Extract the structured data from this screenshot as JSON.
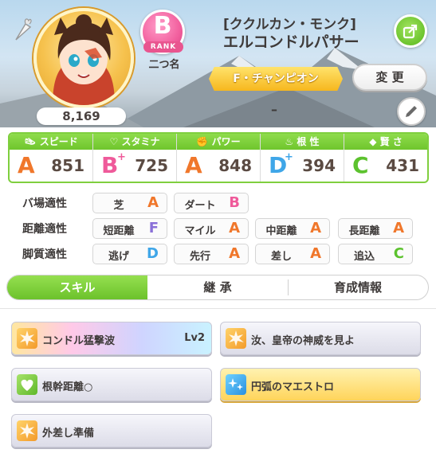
{
  "header": {
    "fans": "8,169",
    "rank": {
      "letter": "B",
      "label": "RANK"
    },
    "nickname": "二つ名",
    "epithet": "[ククルカン・モンク]",
    "uma_name": "エルコンドルパサー",
    "title": "F・チャンピオン",
    "change_label": "変 更",
    "memo": "–"
  },
  "stats": [
    {
      "name": "スピード",
      "icon": "shoe-icon",
      "grade": "A",
      "plus": "",
      "value": "851",
      "color": "#f0772b"
    },
    {
      "name": "スタミナ",
      "icon": "heart-icon",
      "grade": "B",
      "plus": "+",
      "value": "725",
      "color": "#ef5a9a"
    },
    {
      "name": "パワー",
      "icon": "muscle-icon",
      "grade": "A",
      "plus": "",
      "value": "848",
      "color": "#f0772b"
    },
    {
      "name": "根 性",
      "icon": "flame-icon",
      "grade": "D",
      "plus": "+",
      "value": "394",
      "color": "#3fa6e8"
    },
    {
      "name": "賢 さ",
      "icon": "graduation-cap-icon",
      "grade": "C",
      "plus": "",
      "value": "431",
      "color": "#5cc22e"
    }
  ],
  "aptitudes": {
    "track": {
      "label": "バ場適性",
      "items": [
        {
          "name": "芝",
          "grade": "A",
          "color": "#f0772b"
        },
        {
          "name": "ダート",
          "grade": "B",
          "color": "#ef5a9a"
        }
      ]
    },
    "distance": {
      "label": "距離適性",
      "items": [
        {
          "name": "短距離",
          "grade": "F",
          "color": "#8a70d8"
        },
        {
          "name": "マイル",
          "grade": "A",
          "color": "#f0772b"
        },
        {
          "name": "中距離",
          "grade": "A",
          "color": "#f0772b"
        },
        {
          "name": "長距離",
          "grade": "A",
          "color": "#f0772b"
        }
      ]
    },
    "style": {
      "label": "脚質適性",
      "items": [
        {
          "name": "逃げ",
          "grade": "D",
          "color": "#3fa6e8"
        },
        {
          "name": "先行",
          "grade": "A",
          "color": "#f0772b"
        },
        {
          "name": "差し",
          "grade": "A",
          "color": "#f0772b"
        },
        {
          "name": "追込",
          "grade": "C",
          "color": "#5cc22e"
        }
      ]
    }
  },
  "tabs": [
    {
      "label": "スキル",
      "active": true
    },
    {
      "label": "継 承",
      "active": false
    },
    {
      "label": "育成情報",
      "active": false
    }
  ],
  "skills": [
    {
      "name": "コンドル猛撃波",
      "level": "Lv2",
      "icon": "burst-icon",
      "style": "unique"
    },
    {
      "name": "汝、皇帝の神威を見よ",
      "level": "",
      "icon": "burst-icon",
      "style": "normal"
    },
    {
      "name": "根幹距離○",
      "level": "",
      "icon": "heart-icon",
      "style": "normal"
    },
    {
      "name": "円弧のマエストロ",
      "level": "",
      "icon": "sparkle-icon",
      "style": "gold"
    },
    {
      "name": "外差し準備",
      "level": "",
      "icon": "burst-icon",
      "style": "normal"
    }
  ]
}
